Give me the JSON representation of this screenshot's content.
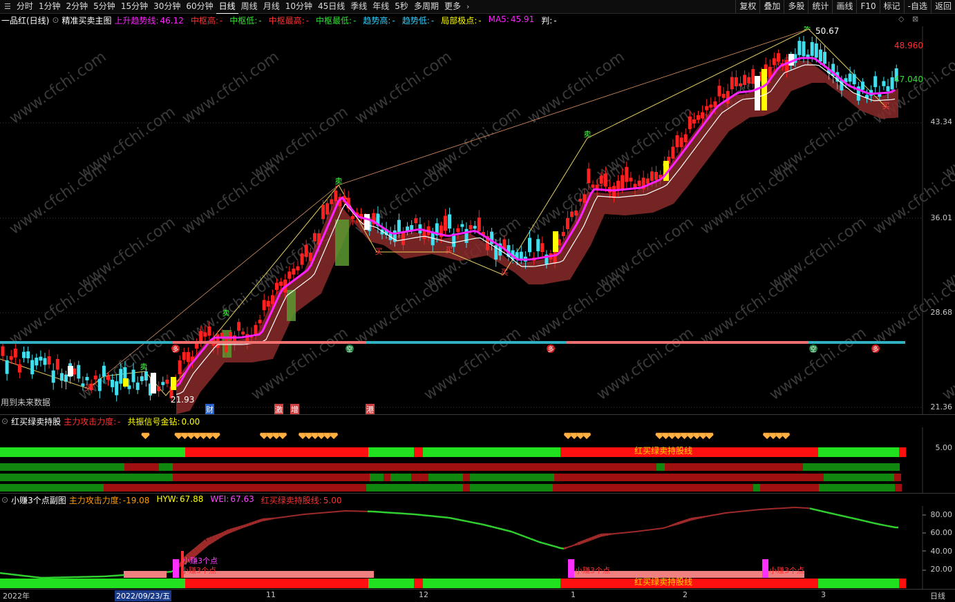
{
  "toolbar": {
    "timeframes": [
      "分时",
      "1分钟",
      "2分钟",
      "5分钟",
      "15分钟",
      "30分钟",
      "60分钟",
      "日线",
      "周线",
      "月线",
      "10分钟",
      "45日线",
      "季线",
      "年线",
      "5秒",
      "多周期",
      "更多"
    ],
    "active": "日线",
    "right_buttons": [
      "复权",
      "叠加",
      "多股",
      "统计",
      "画线",
      "F10",
      "标记",
      "-自选",
      "返回"
    ]
  },
  "main_header": {
    "stock": "一品红(日线)",
    "indicator": "精准买卖主图",
    "items": [
      {
        "label": "上升趋势线:",
        "value": "46.12",
        "color": "#ff22ff"
      },
      {
        "label": "中枢高:",
        "value": "-",
        "color": "#ff3030"
      },
      {
        "label": "中枢低:",
        "value": "-",
        "color": "#30e030"
      },
      {
        "label": "中枢最高:",
        "value": "-",
        "color": "#ff3030"
      },
      {
        "label": "中枢最低:",
        "value": "-",
        "color": "#30e030"
      },
      {
        "label": "趋势高:",
        "value": "-",
        "color": "#30d0ff"
      },
      {
        "label": "趋势低:",
        "value": "-",
        "color": "#30d0ff"
      },
      {
        "label": "局部极点:",
        "value": "-",
        "color": "#ffff00"
      },
      {
        "label": "MA5:",
        "value": "45.91",
        "color": "#ff22ff"
      },
      {
        "label": "判:",
        "value": "-",
        "color": "#ffffff"
      }
    ]
  },
  "price_axis": [
    "43.34",
    "36.01",
    "28.68",
    "21.36"
  ],
  "price_labels": {
    "high": "50.67",
    "low": "21.93",
    "right_top": "48.960",
    "right_mid": "47.040"
  },
  "future_data_note": "用到未来数据",
  "chart_marks": {
    "buy": "买",
    "sell": "卖",
    "long": "多",
    "empty": "空"
  },
  "event_tags": [
    "财",
    "激",
    "增",
    "港"
  ],
  "sub1": {
    "name": "红买绿卖持股",
    "items": [
      {
        "label": "主力攻击力度:",
        "value": "-",
        "color": "#ff3030"
      },
      {
        "label": "共振信号金钻:",
        "value": "0.00",
        "color": "#ffff00"
      }
    ],
    "axis": "5.00",
    "band_label": "红买绿卖持股线"
  },
  "sub2": {
    "name": "小赚3个点副图",
    "items": [
      {
        "label": "主力攻击力度:",
        "value": "-19.08",
        "color": "#ff9900"
      },
      {
        "label": "HYW:",
        "value": "67.88",
        "color": "#ffff00"
      },
      {
        "label": "WEI:",
        "value": "67.63",
        "color": "#ff44ff"
      },
      {
        "label": "红买绿卖持股线:",
        "value": "5.00",
        "color": "#ff3030"
      }
    ],
    "axis": [
      "80.00",
      "60.00",
      "40.00",
      "20.00"
    ],
    "band_label": "红买绿卖持股线",
    "signal_label": "小赚3个点"
  },
  "bottom": {
    "dates": [
      "2022年",
      "2022/09/23/五",
      "11",
      "12",
      "1",
      "2",
      "3"
    ],
    "period": "日线"
  },
  "watermark": "www.cfchi.com",
  "chart_data": {
    "type": "candlestick",
    "title": "一品红(日线)",
    "yaxis_ticks": [
      43.34,
      36.01,
      28.68,
      21.36
    ],
    "high": 50.67,
    "low": 21.93,
    "ma5": 45.91,
    "trend_line": 46.12
  }
}
